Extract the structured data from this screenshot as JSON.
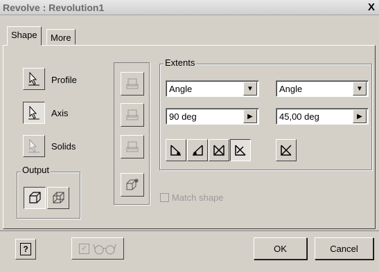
{
  "window": {
    "title": "Revolve : Revolution1",
    "close_label": "X"
  },
  "tabs": [
    {
      "label": "Shape"
    },
    {
      "label": "More"
    }
  ],
  "shape": {
    "profile_label": "Profile",
    "axis_label": "Axis",
    "solids_label": "Solids",
    "output_legend": "Output"
  },
  "extents": {
    "legend": "Extents",
    "left_mode": "Angle",
    "right_mode": "Angle",
    "left_angle": "90 deg",
    "right_angle": "45,00 deg"
  },
  "match_shape_label": "Match shape",
  "footer": {
    "help_label": "?",
    "ok_label": "OK",
    "cancel_label": "Cancel"
  },
  "icons": [
    "arrow-select-icon",
    "operation-join-icon",
    "operation-cut-icon",
    "operation-intersect-icon",
    "new-solid-icon",
    "direction-icon",
    "glasses-icon"
  ]
}
